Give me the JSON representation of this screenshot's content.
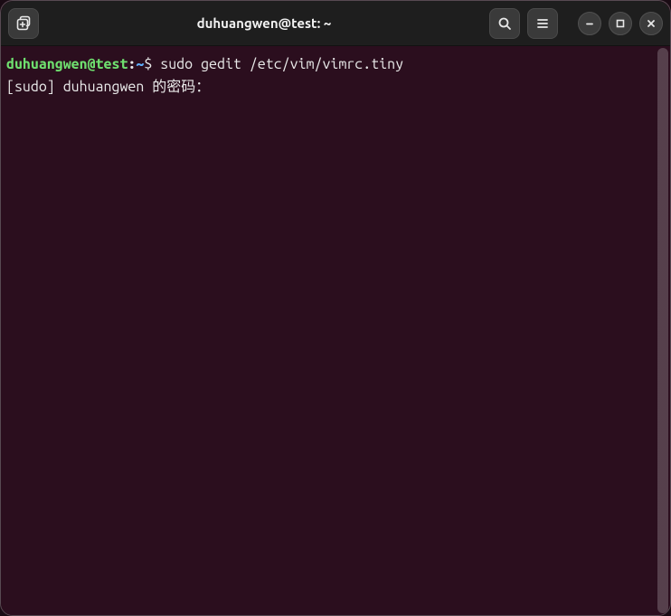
{
  "window": {
    "title": "duhuangwen@test: ~"
  },
  "titlebar": {
    "newtab_icon": "new-tab-icon",
    "search_icon": "search-icon",
    "menu_icon": "hamburger-menu-icon",
    "minimize_icon": "minimize-icon",
    "maximize_icon": "maximize-icon",
    "close_icon": "close-icon"
  },
  "colors": {
    "bg": "#2b0e1e",
    "titlebar_bg": "#1e1e1e",
    "prompt_user": "#6fe06f",
    "prompt_path": "#5fb0ff",
    "text": "#e8e8e8"
  },
  "terminal": {
    "lines": [
      {
        "type": "prompt",
        "userhost": "duhuangwen@test",
        "sep1": ":",
        "path": "~",
        "sep2": "$ ",
        "command": "sudo gedit /etc/vim/vimrc.tiny"
      },
      {
        "type": "output",
        "text": "[sudo] duhuangwen 的密码："
      }
    ]
  }
}
